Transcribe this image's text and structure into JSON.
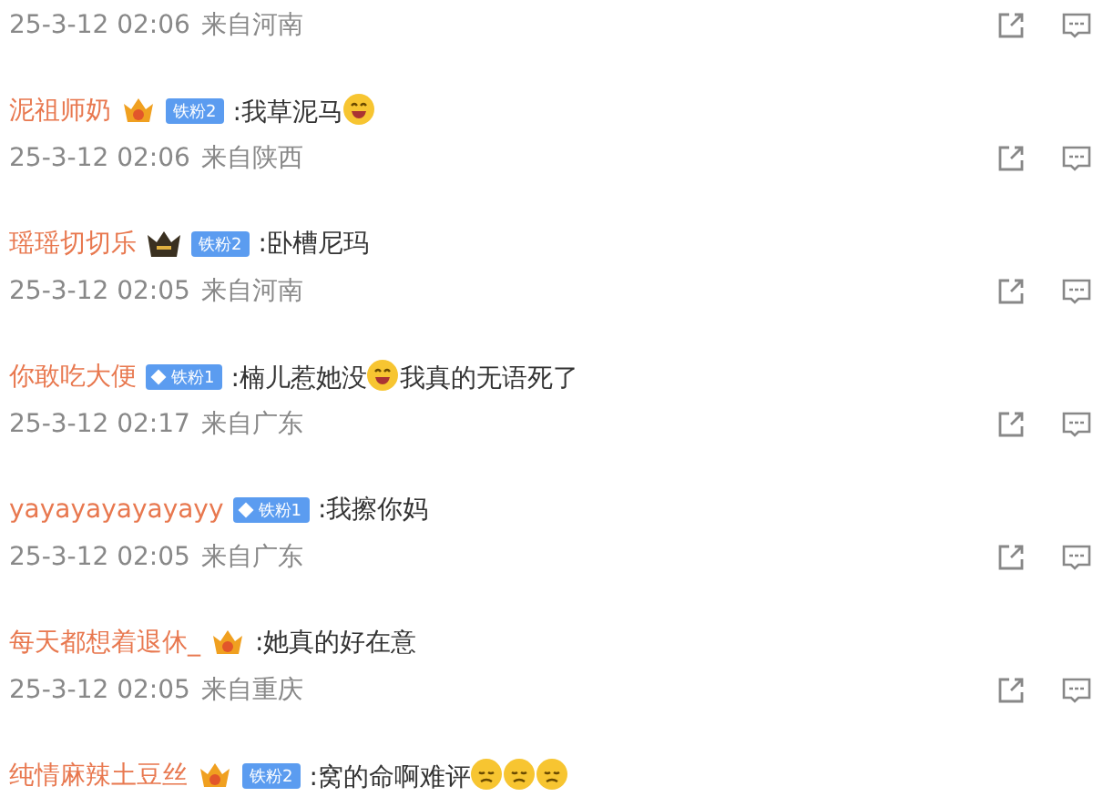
{
  "comments": [
    {
      "time": "25-3-12 02:06",
      "location": "来自河南"
    },
    {
      "user": "泥祖师奶",
      "medal": {
        "kind": "gold"
      },
      "fan_badge": {
        "label": "铁粉2",
        "kind": "plain"
      },
      "content": [
        {
          "kind": "text",
          "text": ":我草泥马"
        },
        {
          "kind": "laugh_emoji"
        }
      ],
      "time": "25-3-12 02:06",
      "location": "来自陕西"
    },
    {
      "user": "瑶瑶切切乐",
      "medal": {
        "kind": "crown"
      },
      "fan_badge": {
        "label": "铁粉2",
        "kind": "plain"
      },
      "content": [
        {
          "kind": "text",
          "text": ":卧槽尼玛"
        }
      ],
      "time": "25-3-12 02:05",
      "location": "来自河南"
    },
    {
      "user": "你敢吃大便",
      "fan_badge": {
        "label": "铁粉1",
        "kind": "diamond"
      },
      "content": [
        {
          "kind": "text",
          "text": ":楠儿惹她没"
        },
        {
          "kind": "laugh_emoji"
        },
        {
          "kind": "text",
          "text": "我真的无语死了"
        }
      ],
      "time": "25-3-12 02:17",
      "location": "来自广东"
    },
    {
      "user": "yayayayayayayy",
      "fan_badge": {
        "label": "铁粉1",
        "kind": "diamond"
      },
      "content": [
        {
          "kind": "text",
          "text": ":我擦你妈"
        }
      ],
      "time": "25-3-12 02:05",
      "location": "来自广东"
    },
    {
      "user": "每天都想着退休_",
      "medal": {
        "kind": "gold"
      },
      "content": [
        {
          "kind": "text",
          "text": ":她真的好在意"
        }
      ],
      "time": "25-3-12 02:05",
      "location": "来自重庆"
    },
    {
      "user": "纯情麻辣土豆丝",
      "medal": {
        "kind": "gold"
      },
      "fan_badge": {
        "label": "铁粉2",
        "kind": "plain"
      },
      "content": [
        {
          "kind": "text",
          "text": ":窝的命啊难评"
        },
        {
          "kind": "sad_emoji"
        },
        {
          "kind": "sad_emoji"
        },
        {
          "kind": "sad_emoji"
        }
      ]
    }
  ]
}
